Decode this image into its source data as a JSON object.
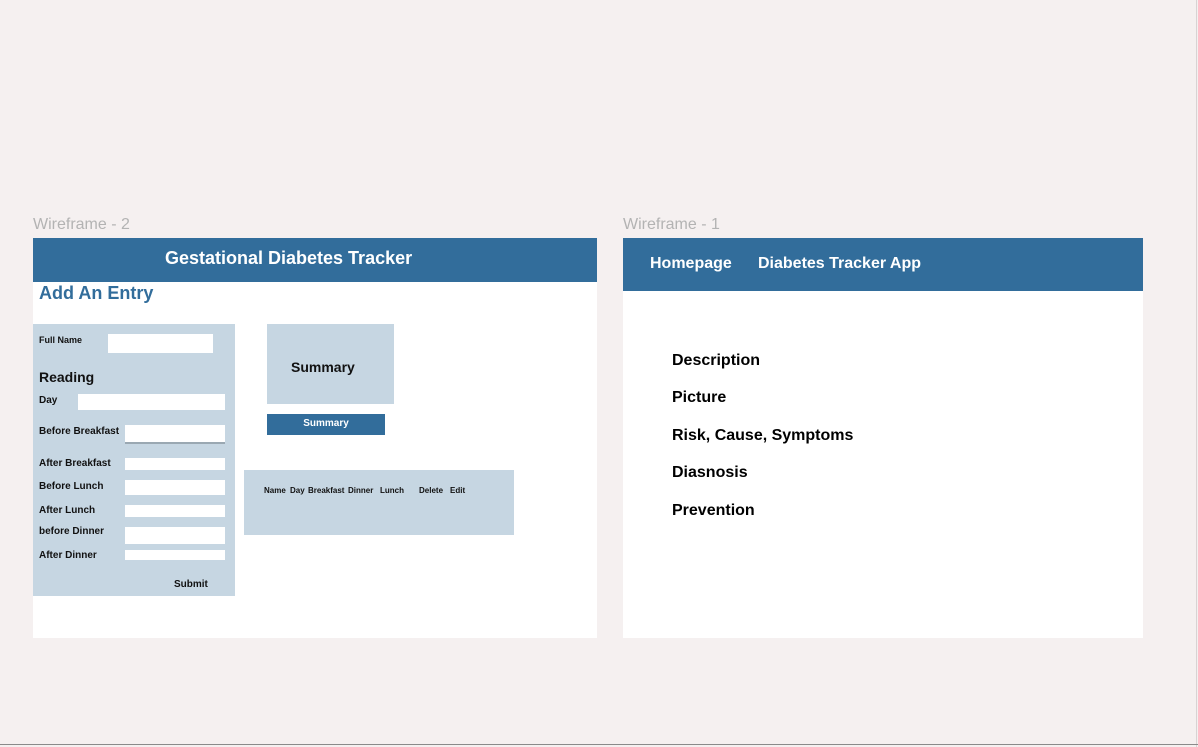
{
  "colors": {
    "canvas": "#f5f0f0",
    "primary": "#326d9b",
    "panel": "#c6d6e2",
    "label_gray": "#b3b3b3"
  },
  "wireframe2": {
    "frame_label": "Wireframe - 2",
    "header_title": "Gestational Diabetes Tracker",
    "page_heading": "Add An Entry",
    "form": {
      "full_name_label": "Full  Name",
      "reading_heading": "Reading",
      "day_label": "Day",
      "before_breakfast_label": "Before Breakfast",
      "after_breakfast_label": "After Breakfast",
      "before_lunch_label": "Before Lunch",
      "after_lunch_label": "After Lunch",
      "before_dinner_label": "before Dinner",
      "after_dinner_label": "After Dinner",
      "submit_label": "Submit"
    },
    "summary_box_label": "Summary",
    "summary_button_label": "Summary",
    "table_headers": {
      "name": "Name",
      "day": "Day",
      "breakfast": "Breakfast",
      "dinner": "Dinner",
      "lunch": "Lunch",
      "delete": "Delete",
      "edit": "Edit"
    }
  },
  "wireframe1": {
    "frame_label": "Wireframe - 1",
    "nav": {
      "homepage": "Homepage",
      "app_title": "Diabetes Tracker App"
    },
    "menu": {
      "description": "Description",
      "picture": "Picture",
      "risk": "Risk, Cause, Symptoms",
      "diagnosis": "Diasnosis",
      "prevention": "Prevention"
    }
  }
}
